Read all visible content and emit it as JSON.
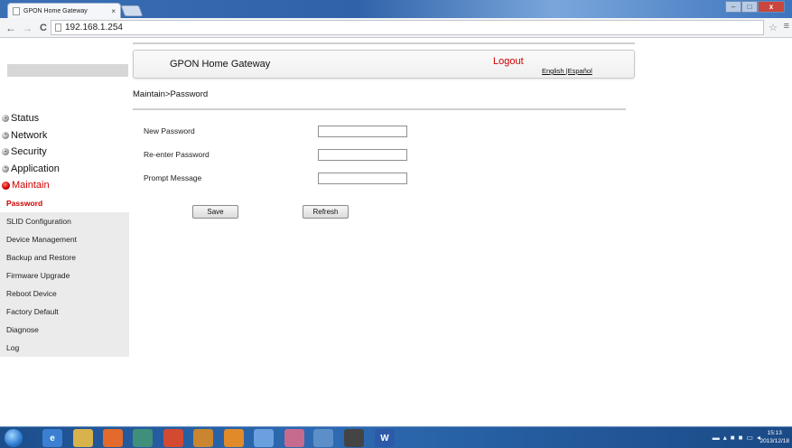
{
  "browser": {
    "tab_title": "GPON Home Gateway",
    "tab_close": "×",
    "url": "192.168.1.254",
    "back": "←",
    "forward": "→",
    "reload": "C",
    "star": "☆",
    "menu": "≡",
    "win_min": "–",
    "win_max": "□",
    "win_close": "x"
  },
  "header": {
    "title": "GPON Home Gateway",
    "logout": "Logout",
    "language": "English |Español"
  },
  "breadcrumb": "Maintain>Password",
  "sidebar": {
    "categories": [
      {
        "label": "Status"
      },
      {
        "label": "Network"
      },
      {
        "label": "Security"
      },
      {
        "label": "Application"
      },
      {
        "label": "Maintain"
      }
    ],
    "subitems": [
      {
        "label": "Password"
      },
      {
        "label": "SLID Configuration"
      },
      {
        "label": "Device Management"
      },
      {
        "label": "Backup and Restore"
      },
      {
        "label": "Firmware Upgrade"
      },
      {
        "label": "Reboot Device"
      },
      {
        "label": "Factory Default"
      },
      {
        "label": "Diagnose"
      },
      {
        "label": "Log"
      }
    ]
  },
  "form": {
    "new_password_label": "New Password",
    "reenter_password_label": "Re-enter Password",
    "prompt_message_label": "Prompt Message",
    "new_password_value": "",
    "reenter_password_value": "",
    "prompt_message_value": ""
  },
  "buttons": {
    "save": "Save",
    "refresh": "Refresh"
  },
  "taskbar": {
    "time": "15:13",
    "date": "2013/12/18",
    "word_label": "W"
  },
  "colors": {
    "accent_red": "#cc0000",
    "titlebar_blue": "#2f63a9"
  }
}
